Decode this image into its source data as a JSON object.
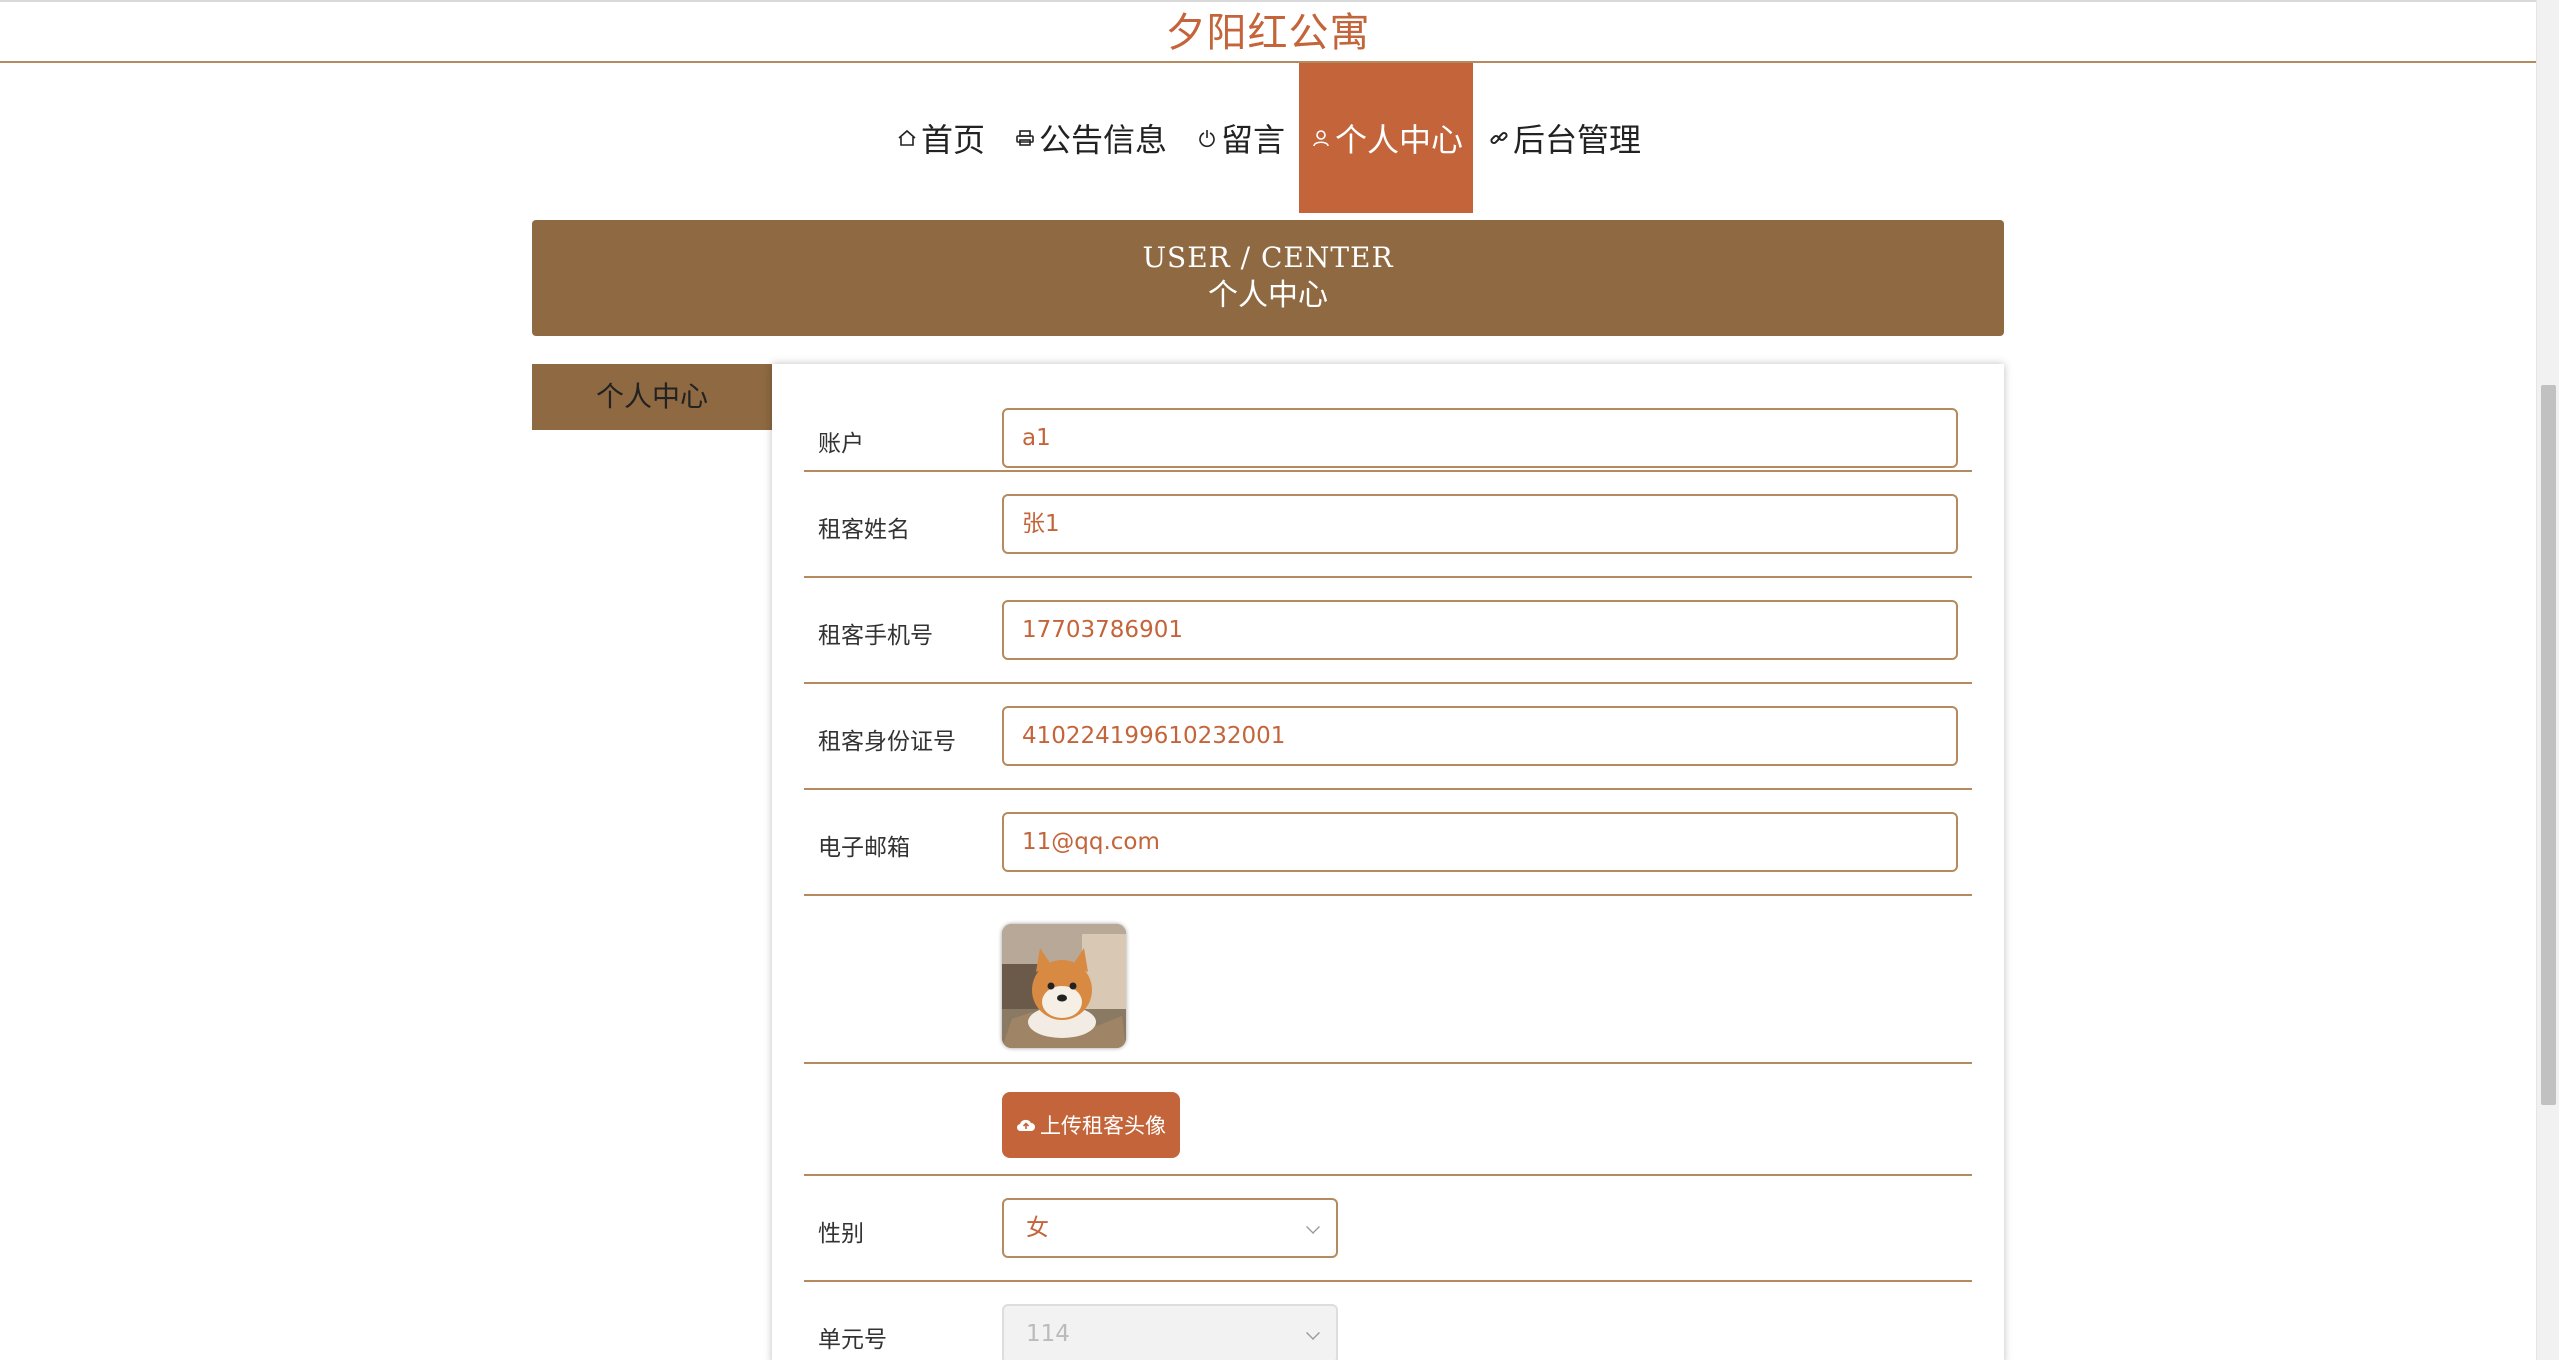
{
  "header": {
    "site_title": "夕阳红公寓"
  },
  "nav": {
    "items": [
      {
        "label": "首页",
        "icon": "home-icon"
      },
      {
        "label": "公告信息",
        "icon": "printer-icon"
      },
      {
        "label": "留言",
        "icon": "power-icon"
      },
      {
        "label": "个人中心",
        "icon": "user-icon",
        "active": true
      },
      {
        "label": "后台管理",
        "icon": "link-icon"
      }
    ]
  },
  "banner": {
    "en": "USER / CENTER",
    "cn": "个人中心"
  },
  "side_menu": {
    "items": [
      {
        "label": "个人中心"
      }
    ]
  },
  "form": {
    "account": {
      "label": "账户",
      "value": "a1"
    },
    "name": {
      "label": "租客姓名",
      "value": "张1"
    },
    "phone": {
      "label": "租客手机号",
      "value": "17703786901"
    },
    "id_card": {
      "label": "租客身份证号",
      "value": "410224199610232001"
    },
    "email": {
      "label": "电子邮箱",
      "value": "11@qq.com"
    },
    "upload_button": "上传租客头像",
    "gender": {
      "label": "性别",
      "value": "女"
    },
    "unit": {
      "label": "单元号",
      "value": "114"
    }
  },
  "colors": {
    "accent": "#c4643a",
    "brown": "#8e6941",
    "border": "#b58a5e"
  }
}
